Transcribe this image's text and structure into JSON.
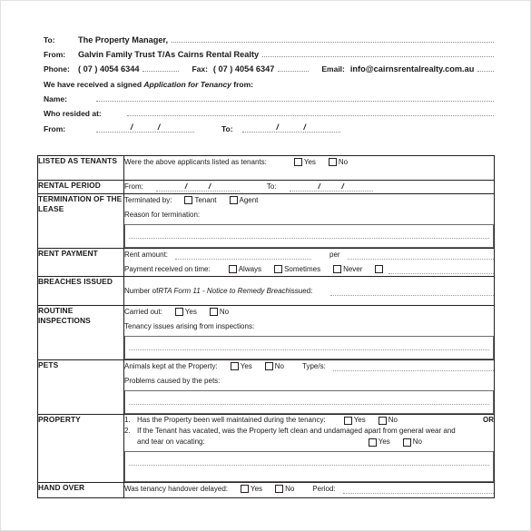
{
  "header": {
    "to_label": "To:",
    "to_value": "The Property Manager,",
    "from_label": "From:",
    "from_value": "Galvin Family Trust T/As Cairns Rental Realty",
    "phone_label": "Phone:",
    "phone_value": "( 07 ) 4054 6344",
    "fax_label": "Fax:",
    "fax_value": "( 07 ) 4054 6347",
    "email_label": "Email:",
    "email_value": "info@cairnsrentalrealty.com.au",
    "received_prefix": "We have received a signed ",
    "received_italic": "Application for Tenancy",
    "received_suffix": " from:",
    "name_label": "Name:",
    "resided_label": "Who resided at:",
    "from_date_label": "From:",
    "to_date_label": "To:",
    "slash": "/"
  },
  "table": {
    "rows": [
      {
        "category": "LISTED AS TENANTS",
        "question": "Were the above applicants listed as tenants:",
        "yes": "Yes",
        "no": "No"
      },
      {
        "category": "RENTAL PERIOD",
        "from_label": "From:",
        "to_label": "To:",
        "slash": "/"
      },
      {
        "category": "TERMINATION OF THE LEASE",
        "terminated_by": "Terminated by:",
        "tenant": "Tenant",
        "agent": "Agent",
        "reason": "Reason for termination:"
      },
      {
        "category": "RENT PAYMENT",
        "rent_amount": "Rent amount:",
        "per": "per",
        "payment_on_time": "Payment received on time:",
        "always": "Always",
        "sometimes": "Sometimes",
        "never": "Never"
      },
      {
        "category": "BREACHES ISSUED",
        "text_prefix": "Number of ",
        "text_italic": "RTA Form 11 - Notice to Remedy Breach",
        "text_suffix": " issued:"
      },
      {
        "category": "ROUTINE INSPECTIONS",
        "carried_out": "Carried out:",
        "yes": "Yes",
        "no": "No",
        "issues": "Tenancy issues arising from inspections:"
      },
      {
        "category": "PETS",
        "animals": "Animals kept at the Property:",
        "yes": "Yes",
        "no": "No",
        "types": "Type/s:",
        "problems": "Problems caused by the pets:"
      },
      {
        "category": "PROPERTY",
        "item1_num": "1.",
        "item1_text": "Has the Property been well maintained during the tenancy:",
        "item1_yes": "Yes",
        "item1_no": "No",
        "or": "OR",
        "item2_num": "2.",
        "item2_text": "If the Tenant has vacated, was the Property left clean and undamaged apart from general wear and",
        "item2_text_cont": "and tear on vacating:",
        "item2_yes": "Yes",
        "item2_no": "No"
      },
      {
        "category": "HAND OVER",
        "question": "Was tenancy handover delayed:",
        "yes": "Yes",
        "no": "No",
        "period": "Period:"
      }
    ]
  },
  "colors": {
    "border": "#231f20",
    "text": "#1a1a1a",
    "dotted": "#9a9a9a",
    "page_edge": "#e2e2e2"
  }
}
